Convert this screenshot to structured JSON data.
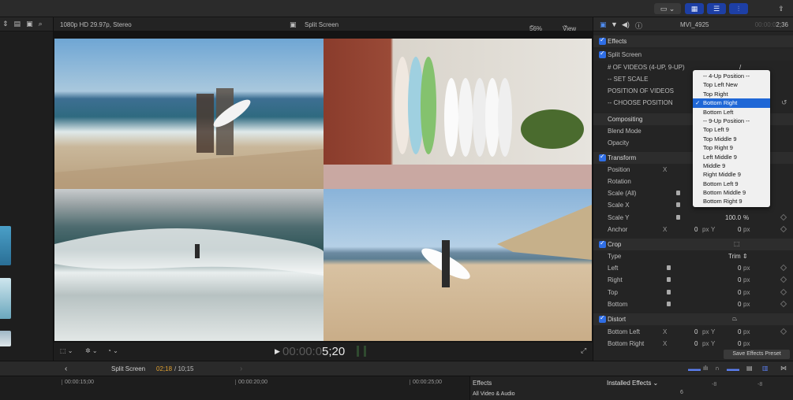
{
  "viewer": {
    "format": "1080p HD 29.97p, Stereo",
    "title": "Split Screen",
    "zoom": "56%",
    "view_menu": "View",
    "timecode_dim": "00:00:0",
    "timecode_bright": "5;20"
  },
  "inspector": {
    "clip_name": "MVI_4925",
    "duration_dim": "00:00:0",
    "duration_bright": "2;36",
    "effects_label": "Effects",
    "split_screen_label": "Split Screen",
    "videos_label": "# OF VIDEOS (4-UP, 9-UP)",
    "videos_value": "/",
    "set_scale_label": "-- SET SCALE",
    "position_videos_label": "POSITION OF VIDEOS",
    "choose_position_label": "-- CHOOSE POSITION",
    "compositing_label": "Compositing",
    "blend_mode_label": "Blend Mode",
    "opacity_label": "Opacity",
    "transform_label": "Transform",
    "position_label": "Position",
    "rotation_label": "Rotation",
    "scale_all_label": "Scale (All)",
    "scale_x_label": "Scale X",
    "scale_y_label": "Scale Y",
    "scale_y_value": "100.0",
    "percent": "%",
    "anchor_label": "Anchor",
    "crop_label": "Crop",
    "type_label": "Type",
    "type_value": "Trim",
    "left_label": "Left",
    "right_label": "Right",
    "top_label": "Top",
    "bottom_label": "Bottom",
    "distort_label": "Distort",
    "bottom_left_label": "Bottom Left",
    "bottom_right_label": "Bottom Right",
    "x": "X",
    "y": "Y",
    "zero": "0",
    "px": "px",
    "save_preset": "Save Effects Preset"
  },
  "dropdown": {
    "items": [
      "-- 4-Up Position --",
      "Top Left New",
      "Top Right",
      "Bottom Right",
      "Bottom Left",
      "-- 9-Up Position --",
      "Top Left 9",
      "Top Middle 9",
      "Top Right 9",
      "Left Middle 9",
      "Middle 9",
      "Right Middle 9",
      "Bottom Left 9",
      "Bottom Middle 9",
      "Bottom Right 9"
    ],
    "selected_index": 3
  },
  "timeline": {
    "project": "Split Screen",
    "position": "02;18",
    "total": "/ 10;15",
    "ruler_marks": [
      "00:00:15;00",
      "00:00:20;00",
      "00:00:25;00"
    ],
    "effects_tab": "Effects",
    "all_video_audio": "All Video & Audio",
    "installed_effects": "Installed Effects",
    "db_left": "-8",
    "db_right": "-8",
    "six": "6"
  },
  "colors": {
    "accent_blue": "#1d3fa5",
    "selection_blue": "#1f67d6",
    "timecode_orange": "#e0a030"
  }
}
